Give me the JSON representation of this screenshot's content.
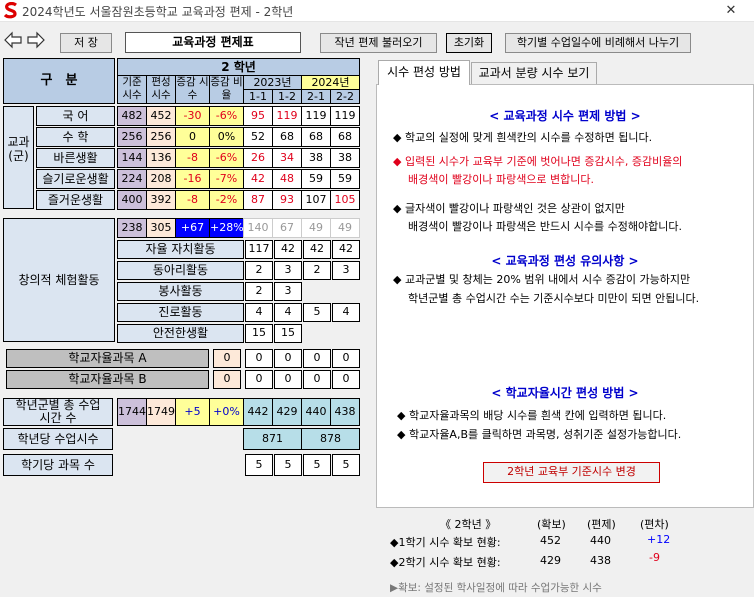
{
  "window": {
    "title": "2024학년도 서울잠원초등학교 교육과정 편제 - 2학년",
    "close": "✕"
  },
  "toolbar": {
    "back_icon": "left-arrow-icon",
    "forward_icon": "right-arrow-icon",
    "save_label": "저 장",
    "page_title": "교육과정 편제표",
    "import_label": "작년 편제 불러오기",
    "reset_label": "초기화",
    "distribute_label": "학기별 수업일수에 비례해서 나누기"
  },
  "table": {
    "corner": "구　분",
    "grade": "2 학년",
    "col_base": "기준 시수",
    "col_plan": "편성 시수",
    "col_delta": "증감 시수",
    "col_ratio": "증감 비율",
    "year_2023": "2023년",
    "year_2024": "2024년",
    "sem_2023_1": "1-1",
    "sem_2023_2": "1-2",
    "sem_2024_1": "2-1",
    "sem_2024_2": "2-2",
    "subject_group_label": "교과 (군)",
    "subjects": [
      {
        "name": "국 어",
        "base": "482",
        "plan": "452",
        "delta": "-30",
        "ratio": "-6%",
        "s1": "95",
        "s2": "119",
        "s3": "119",
        "s4": "119"
      },
      {
        "name": "수 학",
        "base": "256",
        "plan": "256",
        "delta": "0",
        "ratio": "0%",
        "s1": "52",
        "s2": "68",
        "s3": "68",
        "s4": "68"
      },
      {
        "name": "바른생활",
        "base": "144",
        "plan": "136",
        "delta": "-8",
        "ratio": "-6%",
        "s1": "26",
        "s2": "34",
        "s3": "38",
        "s4": "38"
      },
      {
        "name": "슬기로운생활",
        "base": "224",
        "plan": "208",
        "delta": "-16",
        "ratio": "-7%",
        "s1": "42",
        "s2": "48",
        "s3": "59",
        "s4": "59"
      },
      {
        "name": "즐거운생활",
        "base": "400",
        "plan": "392",
        "delta": "-8",
        "ratio": "-2%",
        "s1": "87",
        "s2": "93",
        "s3": "107",
        "s4": "105"
      }
    ],
    "creative": {
      "label": "창의적 체험활동",
      "base": "238",
      "plan": "305",
      "delta": "+67",
      "ratio": "+28%",
      "s1": "140",
      "s2": "67",
      "s3": "49",
      "s4": "49",
      "items": [
        {
          "name": "자율 자치활동",
          "s1": "117",
          "s2": "42",
          "s3": "42",
          "s4": "42"
        },
        {
          "name": "동아리활동",
          "s1": "2",
          "s2": "3",
          "s3": "2",
          "s4": "3"
        },
        {
          "name": "봉사활동",
          "s1": "2",
          "s2": "3",
          "s3": "",
          "s4": ""
        },
        {
          "name": "진로활동",
          "s1": "4",
          "s2": "4",
          "s3": "5",
          "s4": "4"
        },
        {
          "name": "안전한생활",
          "s1": "15",
          "s2": "15",
          "s3": "",
          "s4": ""
        }
      ]
    },
    "school_a": {
      "name": "학교자율과목 A",
      "plan": "0",
      "s1": "0",
      "s2": "0",
      "s3": "0",
      "s4": "0"
    },
    "school_b": {
      "name": "학교자율과목 B",
      "plan": "0",
      "s1": "0",
      "s2": "0",
      "s3": "0",
      "s4": "0"
    },
    "total": {
      "label": "학년군별 총 수업시간 수",
      "base": "1744",
      "plan": "1749",
      "delta": "+5",
      "ratio": "+0%",
      "s1": "442",
      "s2": "429",
      "s3": "440",
      "s4": "438"
    },
    "yearly": {
      "label": "학년당 수업시수",
      "y2023": "871",
      "y2024": "878"
    },
    "subjects_count": {
      "label": "학기당 과목 수",
      "s1": "5",
      "s2": "5",
      "s3": "5",
      "s4": "5"
    }
  },
  "tabs": [
    {
      "label": "시수 편성 방법"
    },
    {
      "label": "교과서 분량 시수 보기"
    }
  ],
  "guide": {
    "h1": "< 교육과정 시수 편제 방법 >",
    "b1": "◆ 학교의 실정에 맞게 흰색칸의 시수를 수정하면 됩니다.",
    "b2a": "◆ 입력된 시수가 교육부 기준에 벗어나면 증감시수, 증감비율의",
    "b2b": "배경색이 빨강이나 파랑색으로 변합니다.",
    "b3a": "◆ 글자색이 빨강이나 파랑색인 것은 상관이 없지만",
    "b3b": "배경색이 빨강이나 파랑색은 반드시 시수를 수정해야합니다.",
    "h2": "< 교육과정 편성 유의사항 >",
    "b4a": "◆ 교과군별 및 창체는 20% 범위 내에서 시수 증감이 가능하지만",
    "b4b": "학년군별 총 수업시간 수는 기준시수보다 미만이 되면 안됩니다.",
    "h3": "< 학교자율시간 편성 방법 >",
    "b5": "◆ 학교자율과목의 배당 시수를 흰색 칸에 입력하면 됩니다.",
    "b6": "◆ 학교자율A,B를 클릭하면 과목명, 성취기준 설정가능합니다.",
    "change_button": "2학년 교육부 기준시수 변경"
  },
  "summary": {
    "grade": "《 2학년 》",
    "col_secured": "(확보)",
    "col_plan": "(편제)",
    "col_diff": "(편차)",
    "row1_label": "◆1학기 시수 확보 현황:",
    "row1_secured": "452",
    "row1_plan": "440",
    "row1_diff": "+12",
    "row2_label": "◆2학기 시수 확보 현황:",
    "row2_secured": "429",
    "row2_plan": "438",
    "row2_diff": "-9",
    "note": "▶확보: 설정된 학사일정에 따라 수업가능한 시수"
  },
  "colors": {
    "header": "#b8cce4",
    "base": "#ccc0da",
    "plan": "#fde9d9",
    "delta": "#ffff99",
    "alert_blue": "#0000ff",
    "total": "#b7dee8",
    "heading": "#0000cc",
    "warning": "#e0001b"
  }
}
